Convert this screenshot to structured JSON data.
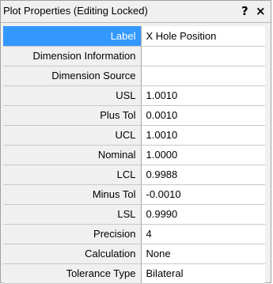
{
  "window": {
    "title": "Plot Properties (Editing Locked)",
    "help_label": "?",
    "close_label": "×"
  },
  "properties": [
    {
      "label": "Label",
      "value": "X Hole Position"
    },
    {
      "label": "Dimension Information",
      "value": ""
    },
    {
      "label": "Dimension Source",
      "value": ""
    },
    {
      "label": "USL",
      "value": "1.0010"
    },
    {
      "label": "Plus Tol",
      "value": "0.0010"
    },
    {
      "label": "UCL",
      "value": "1.0010"
    },
    {
      "label": "Nominal",
      "value": "1.0000"
    },
    {
      "label": "LCL",
      "value": "0.9988"
    },
    {
      "label": "Minus Tol",
      "value": "-0.0010"
    },
    {
      "label": "LSL",
      "value": "0.9990"
    },
    {
      "label": "Precision",
      "value": "4"
    },
    {
      "label": "Calculation",
      "value": "None"
    },
    {
      "label": "Tolerance Type",
      "value": "Bilateral"
    }
  ],
  "colors": {
    "selected_row": "#3399ff",
    "label_bg": "#f0f0f0",
    "value_bg": "#ffffff"
  }
}
